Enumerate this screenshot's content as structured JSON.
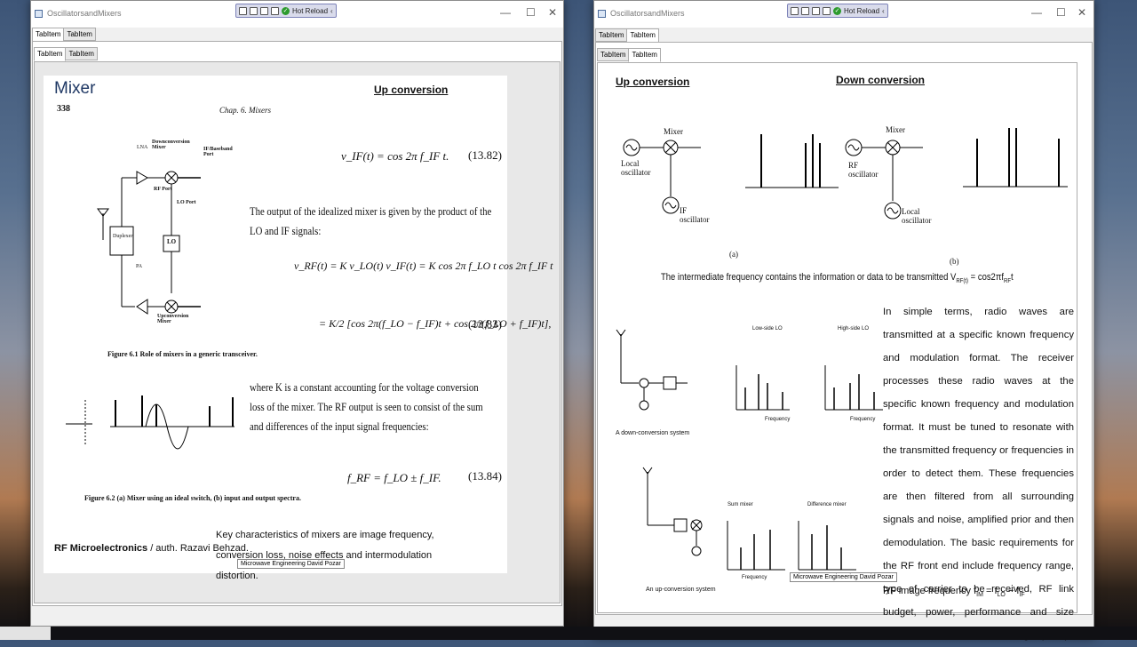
{
  "colors": {
    "title_blue": "#1f3864",
    "accent": "#2d9b2d"
  },
  "left_window": {
    "title": "OscillatorsandMixers",
    "controls": [
      "—",
      "☐",
      "✕"
    ],
    "toolbar": {
      "hot_reload": "Hot Reload",
      "collapse": "‹"
    },
    "outer_tabs": [
      "TabItem",
      "TabItem"
    ],
    "inner_tabs": [
      "TabItem",
      "TabItem"
    ],
    "slide": {
      "title": "Mixer",
      "heading": "Up conversion",
      "page_number": "338",
      "chapter": "Chap. 6.  Mixers",
      "eq1": "v_IF(t) = cos 2π f_IF t.",
      "eq1_num": "(13.82)",
      "text1": "The output of the idealized mixer is given by the product of the LO and IF signals:",
      "eq2": "v_RF(t) = K v_LO(t) v_IF(t) = K cos 2π f_LO t cos 2π f_IF t",
      "eq3": "= K/2 [cos 2π(f_LO − f_IF)t + cos 2π(f_LO + f_IF)t],",
      "eq3_num": "(13.83)",
      "text2": "where K is a constant accounting for the voltage conversion loss of the mixer. The RF output is seen to consist of the sum and differences of the input signal frequencies:",
      "eq4": "f_RF = f_LO ± f_IF.",
      "eq4_num": "(13.84)",
      "fig1_caption": "Figure 6.1  Role of mixers in a generic transceiver.",
      "fig2_caption": "Figure 6.2  (a) Mixer using an ideal switch, (b) input and output spectra.",
      "fig1_labels": {
        "lna": "LNA",
        "down_mixer": "Downconversion Mixer",
        "if_port": "IF/Baseband Port",
        "rf_port": "RF Port",
        "lo_port": "LO Port",
        "lo": "LO",
        "duplexer": "Duplexer",
        "pa": "PA",
        "up_mixer": "Upconversion Mixer"
      },
      "book": "RF Microelectronics",
      "author": " / auth. Razavi Behzad.",
      "key_text": "Key characteristics of mixers are image frequency, conversion loss, noise effects and intermodulation distortion.",
      "source_label": "Microwave Engineering David Pozar"
    }
  },
  "right_window": {
    "title": "OscillatorsandMixers",
    "controls": [
      "—",
      "☐",
      "✕"
    ],
    "toolbar": {
      "hot_reload": "Hot Reload",
      "collapse": "‹"
    },
    "outer_tabs": [
      "TabItem",
      "TabItem"
    ],
    "inner_tabs": [
      "TabItem",
      "TabItem"
    ],
    "slide": {
      "up_heading": "Up conversion",
      "down_heading": "Down conversion",
      "fig_labels": {
        "local_osc": "Local oscillator",
        "if_osc": "IF oscillator",
        "rf_osc": "RF oscillator",
        "mixer": "Mixer",
        "a": "(a)",
        "b": "(b)"
      },
      "if_sentence": "The intermediate frequency contains the information or data to be transmitted V",
      "if_sub": "RF(t)",
      "if_eq": " = cos2πf",
      "if_eq_sub": "RF",
      "if_eq_end": "t",
      "paragraph": "In simple terms, radio waves are transmitted at a specific known frequency and modulation format. The receiver processes these radio waves at the specific known frequency and modulation format. It must be tuned to resonate with the transmitted frequency or frequencies in order to detect them. These frequencies are then filtered from all surrounding signals and noise, amplified prior and then demodulation. The basic requirements for the RF front end include frequency range, type of carrier to be received, RF link budget, power, performance and size restrictions of the front-end design. (EDN)",
      "image_freq": "RF image frequency  f",
      "image_sub": "IM",
      "image_eq": " = f",
      "image_sub2": "LO",
      "image_eq2": " − f",
      "image_sub3": "IF",
      "down_system": "A down-conversion system",
      "up_system": "An up-conversion system",
      "low_side": "Low-side LO",
      "high_side": "High-side LO",
      "sum_mixer": "Sum mixer",
      "diff_mixer": "Difference mixer",
      "frequency": "Frequency",
      "source_label": "Microwave Engineering David Pozar"
    }
  }
}
